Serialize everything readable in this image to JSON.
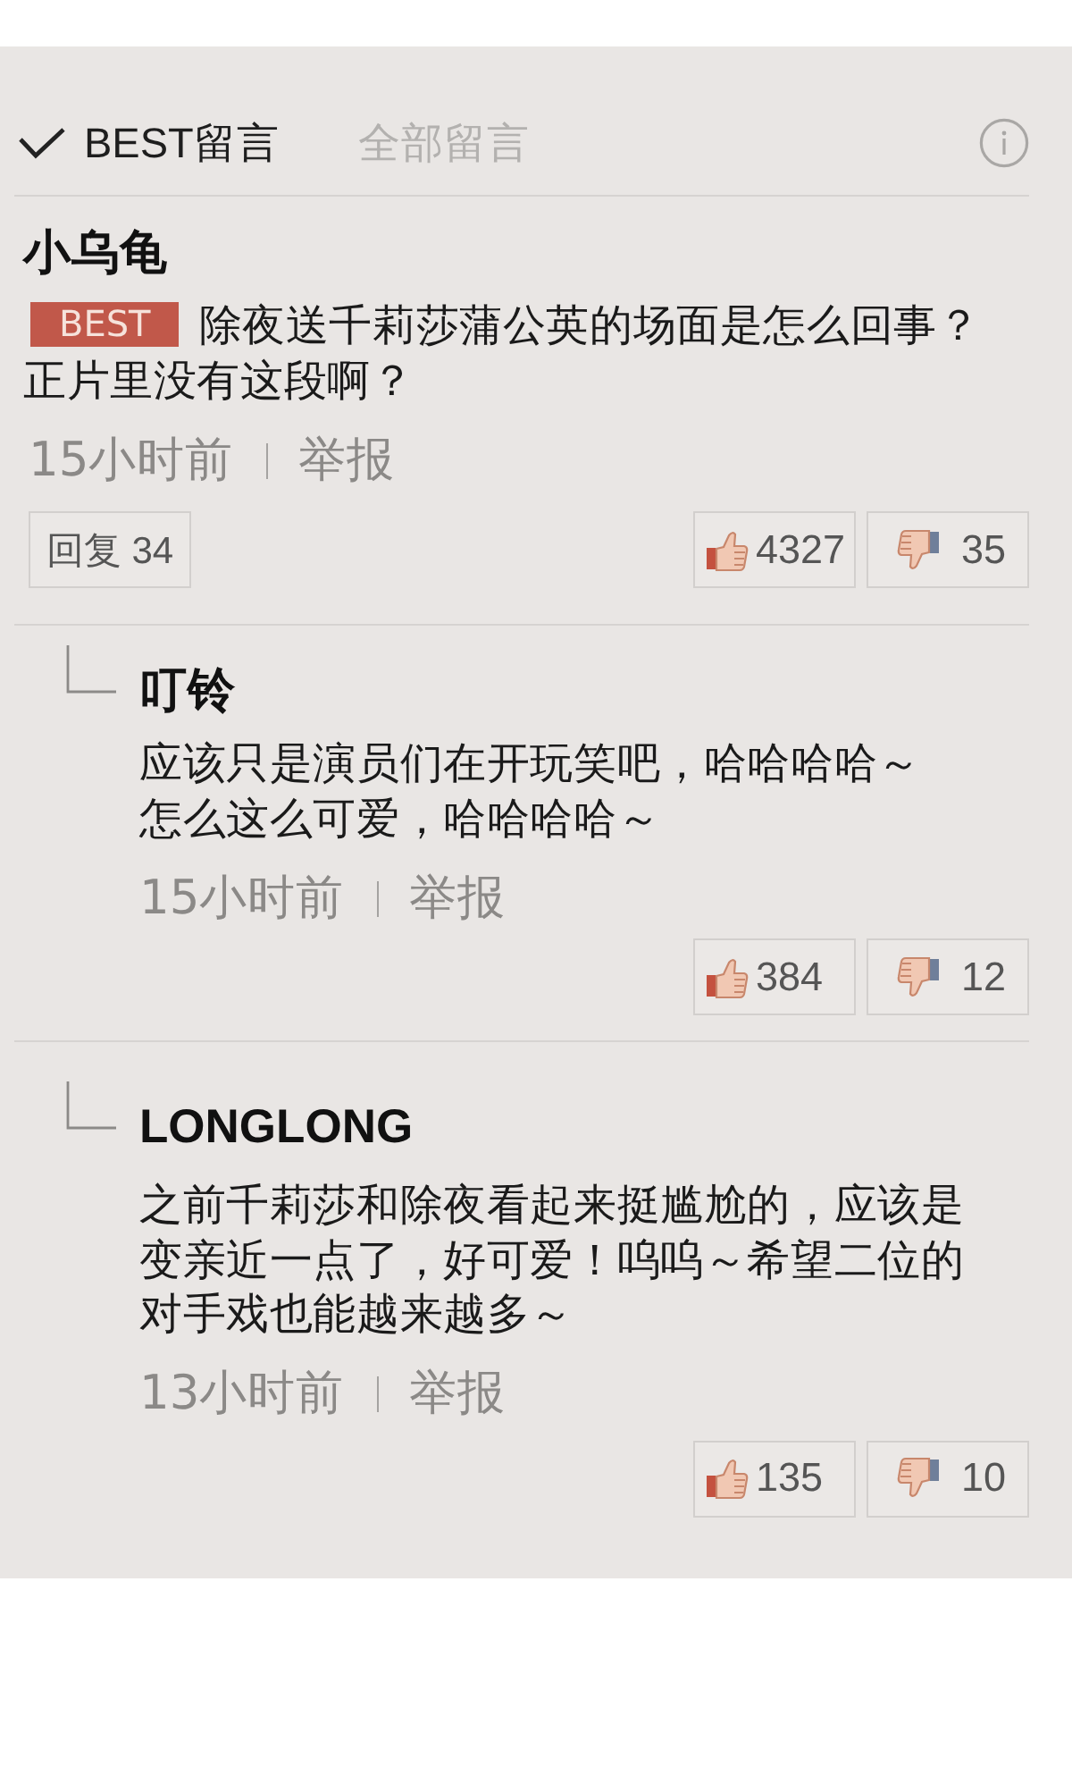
{
  "tabs": [
    {
      "label": "BEST留言",
      "selected": true
    },
    {
      "label": "全部留言",
      "selected": false
    }
  ],
  "comments": [
    {
      "kind": "best",
      "author": "小乌龟",
      "badge": "BEST",
      "paragraphs": [
        "除夜送千莉莎蒲公英的场面是怎么回事？",
        "正片里没有这段啊？"
      ],
      "time": "15小时前",
      "report": "举报",
      "reply_button": "回复 34",
      "likes": "4327",
      "dislikes": "35"
    },
    {
      "kind": "reply",
      "author": "叮铃",
      "paragraphs": [
        "应该只是演员们在开玩笑吧，哈哈哈哈～",
        "怎么这么可爱，哈哈哈哈～"
      ],
      "time": "15小时前",
      "report": "举报",
      "likes": "384",
      "dislikes": "12"
    },
    {
      "kind": "reply",
      "author": "LONGLONG",
      "paragraphs": [
        "之前千莉莎和除夜看起来挺尴尬的，应该是变亲近一点了，好可爱！呜呜～希望二位的对手戏也能越来越多～"
      ],
      "time": "13小时前",
      "report": "举报",
      "likes": "135",
      "dislikes": "10"
    }
  ]
}
